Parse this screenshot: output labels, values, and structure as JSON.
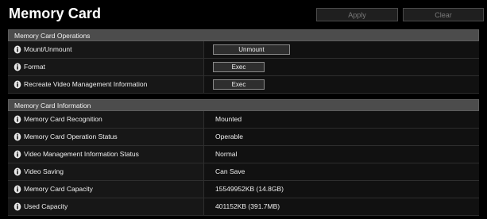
{
  "header": {
    "title": "Memory Card",
    "apply_label": "Apply",
    "clear_label": "Clear"
  },
  "operations": {
    "title": "Memory Card Operations",
    "rows": [
      {
        "label": "Mount/Unmount",
        "button": "Unmount"
      },
      {
        "label": "Format",
        "button": "Exec"
      },
      {
        "label": "Recreate Video Management Information",
        "button": "Exec"
      }
    ]
  },
  "information": {
    "title": "Memory Card Information",
    "rows": [
      {
        "label": "Memory Card Recognition",
        "value": "Mounted"
      },
      {
        "label": "Memory Card Operation Status",
        "value": "Operable"
      },
      {
        "label": "Video Management Information Status",
        "value": "Normal"
      },
      {
        "label": "Video Saving",
        "value": "Can Save"
      },
      {
        "label": "Memory Card Capacity",
        "value": "15549952KB (14.8GB)"
      },
      {
        "label": "Used Capacity",
        "value": "401152KB (391.7MB)"
      }
    ]
  },
  "icons": {
    "row_icon": "info-icon"
  },
  "colors": {
    "background": "#000000",
    "section_header": "#4c4c4c",
    "label_cell": "#171717",
    "value_cell": "#111111"
  }
}
